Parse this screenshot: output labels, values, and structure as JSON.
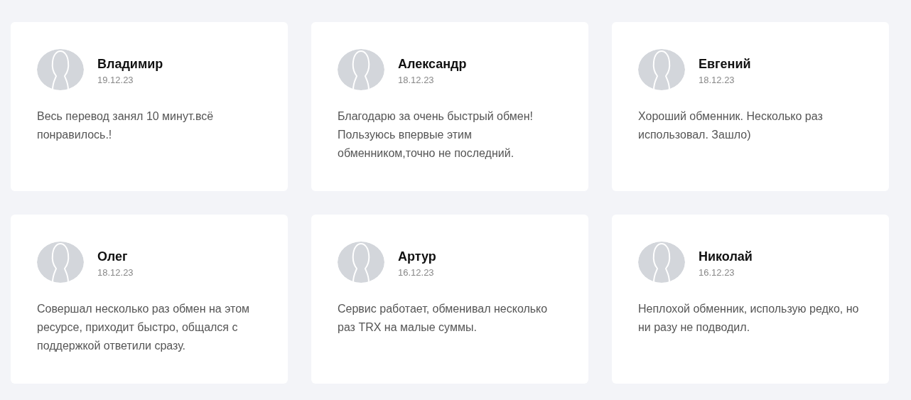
{
  "reviews": [
    {
      "name": "Владимир",
      "date": "19.12.23",
      "text": "Весь перевод занял 10 минут.всё понравилось.!"
    },
    {
      "name": "Александр",
      "date": "18.12.23",
      "text": "Благодарю за очень быстрый обмен! Пользуюсь впервые этим обменником,точно не последний."
    },
    {
      "name": "Евгений",
      "date": "18.12.23",
      "text": "Хороший обменник. Несколько раз использовал. Зашло)"
    },
    {
      "name": "Олег",
      "date": "18.12.23",
      "text": "Совершал несколько раз обмен на этом ресурсе, приходит быстро, общался с поддержкой ответили сразу."
    },
    {
      "name": "Артур",
      "date": "16.12.23",
      "text": "Сервис работает, обменивал несколько раз TRX на малые суммы."
    },
    {
      "name": "Николай",
      "date": "16.12.23",
      "text": "Неплохой обменник, использую редко, но ни разу не подводил."
    }
  ]
}
